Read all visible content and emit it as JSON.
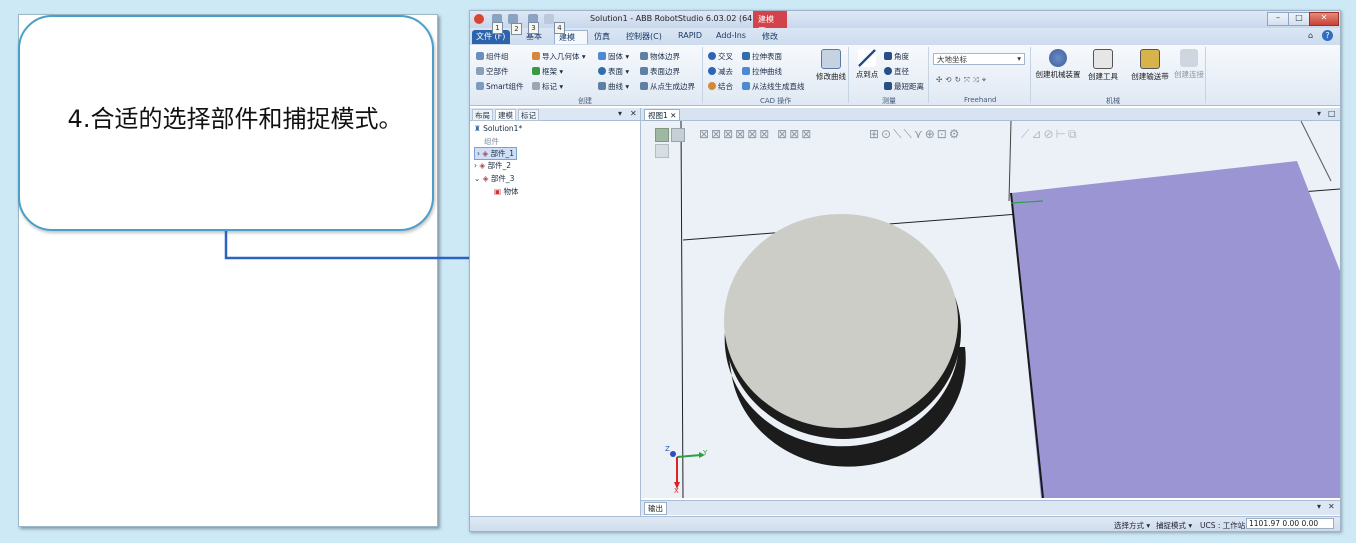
{
  "callout": {
    "text": "4.合适的选择部件和捕捉模式。"
  },
  "app": {
    "title": "Solution1 - ABB RobotStudio 6.03.02 (64...",
    "context_tab": "建模工...",
    "window_buttons": {
      "minimize": "–",
      "restore": "□",
      "close": "✕"
    },
    "tabs": [
      {
        "label": "文件 (F)",
        "key": "F"
      },
      {
        "label": "基本",
        "key": "1"
      },
      {
        "label": "建模",
        "key": "2"
      },
      {
        "label": "仿真",
        "key": "3"
      },
      {
        "label": "控制器(C)",
        "key": "C"
      },
      {
        "label": "RAPID",
        "key": "R"
      },
      {
        "label": "Add-Ins",
        "key": "A"
      },
      {
        "label": "修改",
        "key": "4"
      }
    ],
    "ribbon": {
      "create": {
        "group_label": "创建",
        "items": [
          "组件组",
          "空部件",
          "Smart组件",
          "导入几何体",
          "框架",
          "标记",
          "固体",
          "表面",
          "曲线",
          "物体边界",
          "表面边界",
          "从点生成边界"
        ]
      },
      "cad": {
        "group_label": "CAD 操作",
        "items": [
          "交叉",
          "拉伸表面",
          "减去",
          "拉伸曲线",
          "结合",
          "从法线生成直线"
        ],
        "modify_curve": "修改曲线"
      },
      "measure": {
        "group_label": "测量",
        "items": [
          "点到点",
          "角度",
          "直径",
          "最短距离"
        ]
      },
      "freehand": {
        "group_label": "Freehand",
        "frame_combo": "大地坐标"
      },
      "mechanism": {
        "group_label": "机械",
        "items": [
          "创建机械装置",
          "创建工具",
          "创建输送带",
          "创建连接"
        ]
      }
    },
    "layout_pane": {
      "tabs": [
        "布局",
        "建模",
        "标记"
      ],
      "tree": {
        "root": "Solution1*",
        "section": "组件",
        "items": [
          "部件_1",
          "部件_2",
          "部件_3"
        ],
        "child": "物体"
      }
    },
    "view": {
      "tab": "视图1",
      "axes": {
        "x": "X",
        "y": "Y",
        "z": "Z"
      }
    },
    "output_tab": "输出",
    "status": {
      "selection_mode": "选择方式 ▾",
      "snap_mode": "捕捉模式 ▾",
      "ucs": "UCS : 工作站",
      "coords": "1101.97  0.00  0.00"
    },
    "colors": {
      "box_face": "#9b96d3",
      "cylinder_top": "#cdcdc8",
      "cylinder_side": "#1c1c1c",
      "arrow": "#2a63c4"
    }
  }
}
